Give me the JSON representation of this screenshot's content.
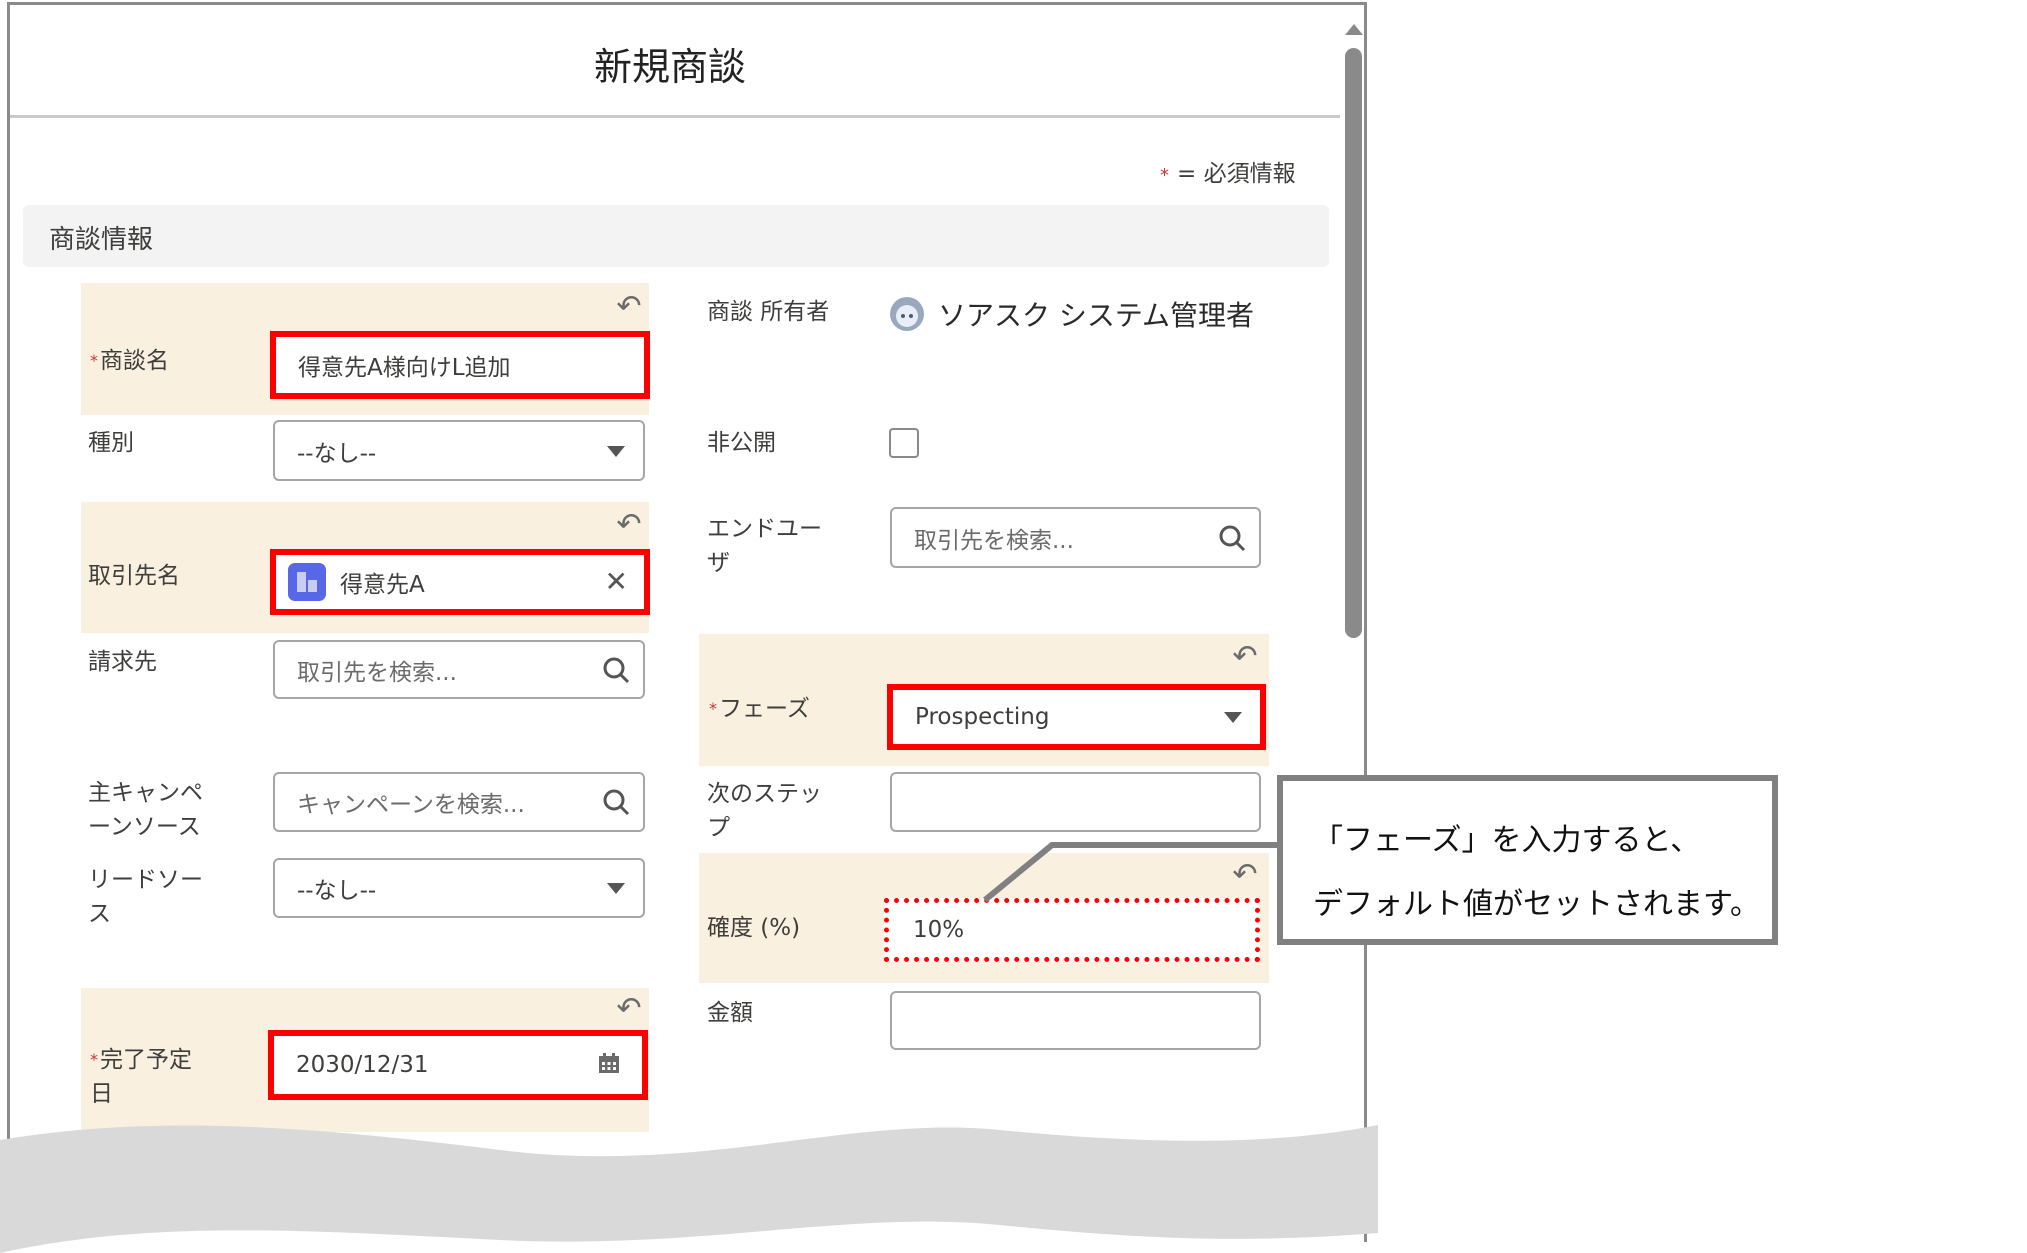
{
  "dialog": {
    "title": "新規商談",
    "required_note": {
      "star": "*",
      "text": "= 必須情報"
    },
    "section_title": "商談情報"
  },
  "left_fields": {
    "opportunity_name": {
      "label": "商談名",
      "required": true,
      "value": "得意先A様向けL追加"
    },
    "type": {
      "label": "種別",
      "value": "--なし--"
    },
    "account_name": {
      "label": "取引先名",
      "value": "得意先A",
      "icon": "account-building-icon"
    },
    "bill_to": {
      "label": "請求先",
      "placeholder": "取引先を検索..."
    },
    "primary_campaign": {
      "label_line1": "主キャンペ",
      "label_line2": "ーンソース",
      "placeholder": "キャンペーンを検索..."
    },
    "lead_source": {
      "label_line1": "リードソー",
      "label_line2": "ス",
      "value": "--なし--"
    },
    "close_date": {
      "label_line1": "完了予定",
      "label_line2": "日",
      "required": true,
      "value": "2030/12/31"
    }
  },
  "right_fields": {
    "owner": {
      "label": "商談 所有者",
      "value": "ソアスク システム管理者"
    },
    "private": {
      "label": "非公開",
      "checked": false
    },
    "end_user": {
      "label_line1": "エンドユー",
      "label_line2": "ザ",
      "placeholder": "取引先を検索..."
    },
    "stage": {
      "label": "フェーズ",
      "required": true,
      "value": "Prospecting"
    },
    "next_step": {
      "label_line1": "次のステッ",
      "label_line2": "プ",
      "value": ""
    },
    "probability": {
      "label": "確度 (%)",
      "value": "10%"
    },
    "amount": {
      "label": "金額",
      "value": ""
    }
  },
  "icons": {
    "undo": "↶",
    "clear": "✕",
    "star": "*"
  },
  "callout": {
    "line1": "「フェーズ」を入力すると、",
    "line2": "デフォルト値がセットされます。"
  },
  "colors": {
    "highlight_red": "#ff0000",
    "changed_field_bg": "#faf0e0",
    "account_icon": "#5867e8",
    "callout_border": "#808080"
  }
}
